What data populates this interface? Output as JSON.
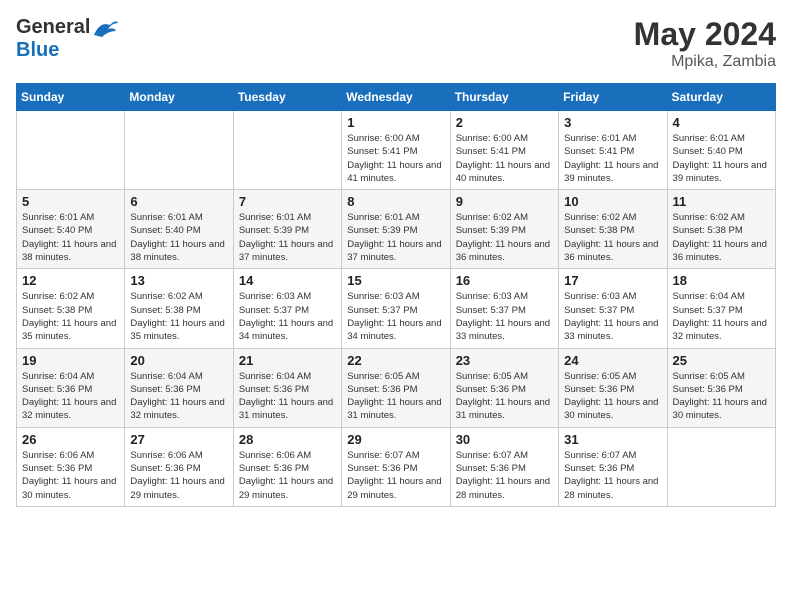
{
  "header": {
    "logo_general": "General",
    "logo_blue": "Blue",
    "month_year": "May 2024",
    "location": "Mpika, Zambia"
  },
  "weekdays": [
    "Sunday",
    "Monday",
    "Tuesday",
    "Wednesday",
    "Thursday",
    "Friday",
    "Saturday"
  ],
  "weeks": [
    [
      {
        "day": "",
        "info": ""
      },
      {
        "day": "",
        "info": ""
      },
      {
        "day": "",
        "info": ""
      },
      {
        "day": "1",
        "info": "Sunrise: 6:00 AM\nSunset: 5:41 PM\nDaylight: 11 hours\nand 41 minutes."
      },
      {
        "day": "2",
        "info": "Sunrise: 6:00 AM\nSunset: 5:41 PM\nDaylight: 11 hours\nand 40 minutes."
      },
      {
        "day": "3",
        "info": "Sunrise: 6:01 AM\nSunset: 5:41 PM\nDaylight: 11 hours\nand 39 minutes."
      },
      {
        "day": "4",
        "info": "Sunrise: 6:01 AM\nSunset: 5:40 PM\nDaylight: 11 hours\nand 39 minutes."
      }
    ],
    [
      {
        "day": "5",
        "info": "Sunrise: 6:01 AM\nSunset: 5:40 PM\nDaylight: 11 hours\nand 38 minutes."
      },
      {
        "day": "6",
        "info": "Sunrise: 6:01 AM\nSunset: 5:40 PM\nDaylight: 11 hours\nand 38 minutes."
      },
      {
        "day": "7",
        "info": "Sunrise: 6:01 AM\nSunset: 5:39 PM\nDaylight: 11 hours\nand 37 minutes."
      },
      {
        "day": "8",
        "info": "Sunrise: 6:01 AM\nSunset: 5:39 PM\nDaylight: 11 hours\nand 37 minutes."
      },
      {
        "day": "9",
        "info": "Sunrise: 6:02 AM\nSunset: 5:39 PM\nDaylight: 11 hours\nand 36 minutes."
      },
      {
        "day": "10",
        "info": "Sunrise: 6:02 AM\nSunset: 5:38 PM\nDaylight: 11 hours\nand 36 minutes."
      },
      {
        "day": "11",
        "info": "Sunrise: 6:02 AM\nSunset: 5:38 PM\nDaylight: 11 hours\nand 36 minutes."
      }
    ],
    [
      {
        "day": "12",
        "info": "Sunrise: 6:02 AM\nSunset: 5:38 PM\nDaylight: 11 hours\nand 35 minutes."
      },
      {
        "day": "13",
        "info": "Sunrise: 6:02 AM\nSunset: 5:38 PM\nDaylight: 11 hours\nand 35 minutes."
      },
      {
        "day": "14",
        "info": "Sunrise: 6:03 AM\nSunset: 5:37 PM\nDaylight: 11 hours\nand 34 minutes."
      },
      {
        "day": "15",
        "info": "Sunrise: 6:03 AM\nSunset: 5:37 PM\nDaylight: 11 hours\nand 34 minutes."
      },
      {
        "day": "16",
        "info": "Sunrise: 6:03 AM\nSunset: 5:37 PM\nDaylight: 11 hours\nand 33 minutes."
      },
      {
        "day": "17",
        "info": "Sunrise: 6:03 AM\nSunset: 5:37 PM\nDaylight: 11 hours\nand 33 minutes."
      },
      {
        "day": "18",
        "info": "Sunrise: 6:04 AM\nSunset: 5:37 PM\nDaylight: 11 hours\nand 32 minutes."
      }
    ],
    [
      {
        "day": "19",
        "info": "Sunrise: 6:04 AM\nSunset: 5:36 PM\nDaylight: 11 hours\nand 32 minutes."
      },
      {
        "day": "20",
        "info": "Sunrise: 6:04 AM\nSunset: 5:36 PM\nDaylight: 11 hours\nand 32 minutes."
      },
      {
        "day": "21",
        "info": "Sunrise: 6:04 AM\nSunset: 5:36 PM\nDaylight: 11 hours\nand 31 minutes."
      },
      {
        "day": "22",
        "info": "Sunrise: 6:05 AM\nSunset: 5:36 PM\nDaylight: 11 hours\nand 31 minutes."
      },
      {
        "day": "23",
        "info": "Sunrise: 6:05 AM\nSunset: 5:36 PM\nDaylight: 11 hours\nand 31 minutes."
      },
      {
        "day": "24",
        "info": "Sunrise: 6:05 AM\nSunset: 5:36 PM\nDaylight: 11 hours\nand 30 minutes."
      },
      {
        "day": "25",
        "info": "Sunrise: 6:05 AM\nSunset: 5:36 PM\nDaylight: 11 hours\nand 30 minutes."
      }
    ],
    [
      {
        "day": "26",
        "info": "Sunrise: 6:06 AM\nSunset: 5:36 PM\nDaylight: 11 hours\nand 30 minutes."
      },
      {
        "day": "27",
        "info": "Sunrise: 6:06 AM\nSunset: 5:36 PM\nDaylight: 11 hours\nand 29 minutes."
      },
      {
        "day": "28",
        "info": "Sunrise: 6:06 AM\nSunset: 5:36 PM\nDaylight: 11 hours\nand 29 minutes."
      },
      {
        "day": "29",
        "info": "Sunrise: 6:07 AM\nSunset: 5:36 PM\nDaylight: 11 hours\nand 29 minutes."
      },
      {
        "day": "30",
        "info": "Sunrise: 6:07 AM\nSunset: 5:36 PM\nDaylight: 11 hours\nand 28 minutes."
      },
      {
        "day": "31",
        "info": "Sunrise: 6:07 AM\nSunset: 5:36 PM\nDaylight: 11 hours\nand 28 minutes."
      },
      {
        "day": "",
        "info": ""
      }
    ]
  ]
}
